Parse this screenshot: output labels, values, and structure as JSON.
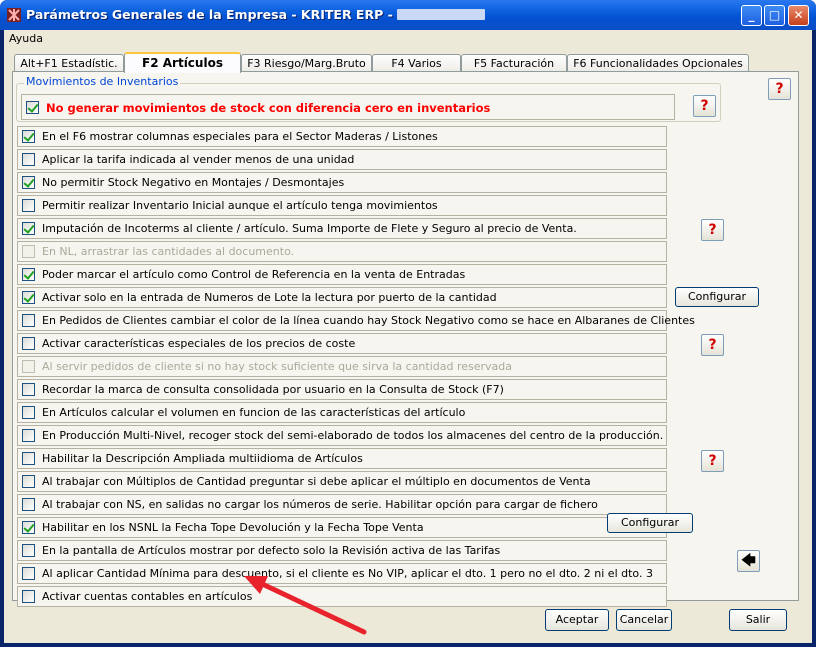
{
  "window": {
    "title": "Parámetros Generales de la Empresa - KRITER ERP -",
    "controls": {
      "minimize": "_",
      "maximize": "□",
      "close": "✕"
    }
  },
  "menu": {
    "items": [
      "Ayuda"
    ]
  },
  "tabs": [
    {
      "label": "Alt+F1 Estadístic.",
      "active": false
    },
    {
      "label": "F2 Artículos",
      "active": true
    },
    {
      "label": "F3 Riesgo/Marg.Bruto",
      "active": false
    },
    {
      "label": "F4 Varios",
      "active": false
    },
    {
      "label": "F5 Facturación",
      "active": false
    },
    {
      "label": "F6 Funcionalidades Opcionales",
      "active": false
    }
  ],
  "group": {
    "legend": "Movimientos de Inventarios",
    "option": {
      "label": "No generar movimientos de stock con diferencia cero en inventarios",
      "checked": true
    }
  },
  "options": [
    {
      "label": "En el F6 mostrar columnas especiales para el Sector Maderas / Listones",
      "checked": true,
      "disabled": false
    },
    {
      "label": "Aplicar la tarifa indicada al vender menos de una unidad",
      "checked": false,
      "disabled": false
    },
    {
      "label": "No permitir Stock Negativo en Montajes / Desmontajes",
      "checked": true,
      "disabled": false
    },
    {
      "label": "Permitir realizar Inventario Inicial aunque el artículo tenga movimientos",
      "checked": false,
      "disabled": false
    },
    {
      "label": "Imputación de Incoterms al cliente / artículo.  Suma Importe de Flete y Seguro al precio de Venta.",
      "checked": true,
      "disabled": false
    },
    {
      "label": "En NL, arrastrar las cantidades al documento.",
      "checked": false,
      "disabled": true
    },
    {
      "label": "Poder marcar el artículo como Control de Referencia en la venta de Entradas",
      "checked": true,
      "disabled": false
    },
    {
      "label": "Activar solo en la entrada de Numeros de Lote la lectura por puerto de la cantidad",
      "checked": true,
      "disabled": false
    },
    {
      "label": "En Pedidos de Clientes cambiar el color de la línea cuando hay Stock Negativo como se hace en Albaranes de Clientes",
      "checked": false,
      "disabled": false
    },
    {
      "label": "Activar características especiales de los precios de coste",
      "checked": false,
      "disabled": false
    },
    {
      "label": "Al servir pedidos de cliente si no hay stock suficiente que sirva la cantidad reservada",
      "checked": false,
      "disabled": true
    },
    {
      "label": "Recordar la marca de consulta consolidada por usuario en la Consulta de Stock (F7)",
      "checked": false,
      "disabled": false
    },
    {
      "label": "En Artículos calcular el volumen en funcion de las características del artículo",
      "checked": false,
      "disabled": false
    },
    {
      "label": "En Producción Multi-Nivel, recoger stock del semi-elaborado de todos los almacenes del centro de la producción.",
      "checked": false,
      "disabled": false
    },
    {
      "label": "Habilitar la Descripción Ampliada multiidioma de Artículos",
      "checked": false,
      "disabled": false
    },
    {
      "label": "Al trabajar con Múltiplos de Cantidad preguntar si debe aplicar el múltiplo en documentos de Venta",
      "checked": false,
      "disabled": false
    },
    {
      "label": "Al trabajar con NS, en salidas no cargar los números de serie. Habilitar opción para cargar de fichero",
      "checked": false,
      "disabled": false
    },
    {
      "label": "Habilitar en los NSNL la Fecha Tope Devolución y la Fecha Tope Venta",
      "checked": true,
      "disabled": false
    },
    {
      "label": "En la pantalla de Artículos mostrar por defecto solo la Revisión activa de las Tarifas",
      "checked": false,
      "disabled": false
    },
    {
      "label": "Al aplicar Cantidad Mínima para descuento, si el cliente es No VIP, aplicar el dto. 1 pero no el dto. 2 ni el dto. 3",
      "checked": false,
      "disabled": false
    },
    {
      "label": "Activar cuentas contables en artículos",
      "checked": false,
      "disabled": false
    }
  ],
  "buttons": {
    "configurar_lote": "Configurar",
    "configurar_nsnl": "Configurar",
    "help_glyph": "?",
    "back_glyph": "🡄",
    "accept": "Aceptar",
    "cancel": "Cancelar",
    "exit": "Salir"
  },
  "colors": {
    "title_bar": "#0a5fdc",
    "active_tab_top": "#ffc83c",
    "group_legend": "#0046d5",
    "strong_option": "#ff0000",
    "check_mark": "#21a121",
    "annotation_arrow": "#e8232b"
  },
  "icons": [
    "app-icon",
    "help-icon",
    "back-arrow-icon"
  ]
}
